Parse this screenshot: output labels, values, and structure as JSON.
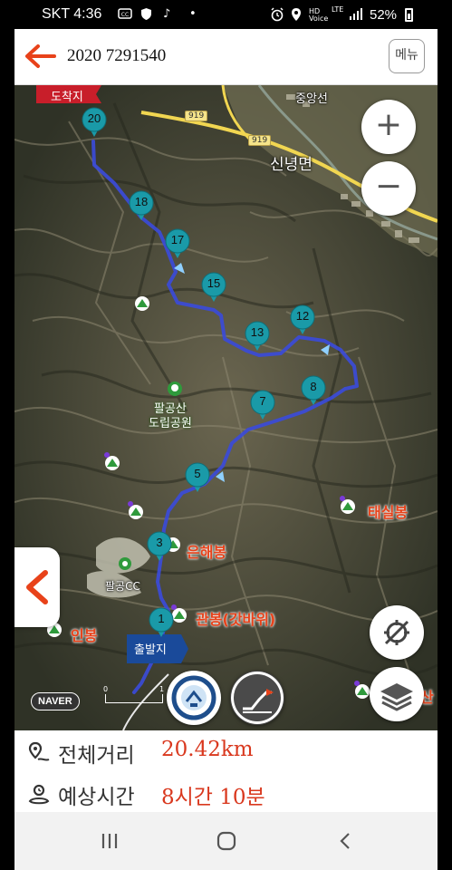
{
  "status_bar": {
    "time": "SKT 4:36",
    "battery": "52%",
    "icons": [
      "cc-icon",
      "shield-icon",
      "music-note-icon",
      "alarm-icon",
      "location-icon",
      "hd-voice-icon",
      "lte-icon",
      "signal-icon",
      "battery-icon"
    ]
  },
  "header": {
    "title": "2020 7291540",
    "menu_label": "메뉴"
  },
  "map": {
    "labels": {
      "top_line": "중앙선",
      "town": "신녕면",
      "park_name": "팔공산\n도립공원",
      "golf": "팔공CC"
    },
    "road_numbers": [
      "919",
      "919"
    ],
    "peaks": {
      "taesilbong": "태실봉",
      "eunhaebong": "은해봉",
      "gwanbong": "관봉(갓바위)",
      "inbong": "인봉",
      "partial": "산"
    },
    "flags": {
      "start": "출발지",
      "end": "도착지"
    },
    "waypoints": [
      "20",
      "18",
      "17",
      "15",
      "13",
      "12",
      "8",
      "7",
      "5",
      "3",
      "1"
    ],
    "attribution": "NAVER",
    "scale": [
      "0",
      "1"
    ],
    "colors": {
      "route": "#3b4bd8",
      "waypoint": "#1a9aa8",
      "peak_label": "#e8421a",
      "flag": "#1a4a9a"
    }
  },
  "controls": {
    "zoom_in": "+",
    "zoom_out": "−"
  },
  "info": {
    "distance_label": "전체거리",
    "distance_value": "20.42km",
    "time_label": "예상시간",
    "time_value": "8시간 10분"
  }
}
